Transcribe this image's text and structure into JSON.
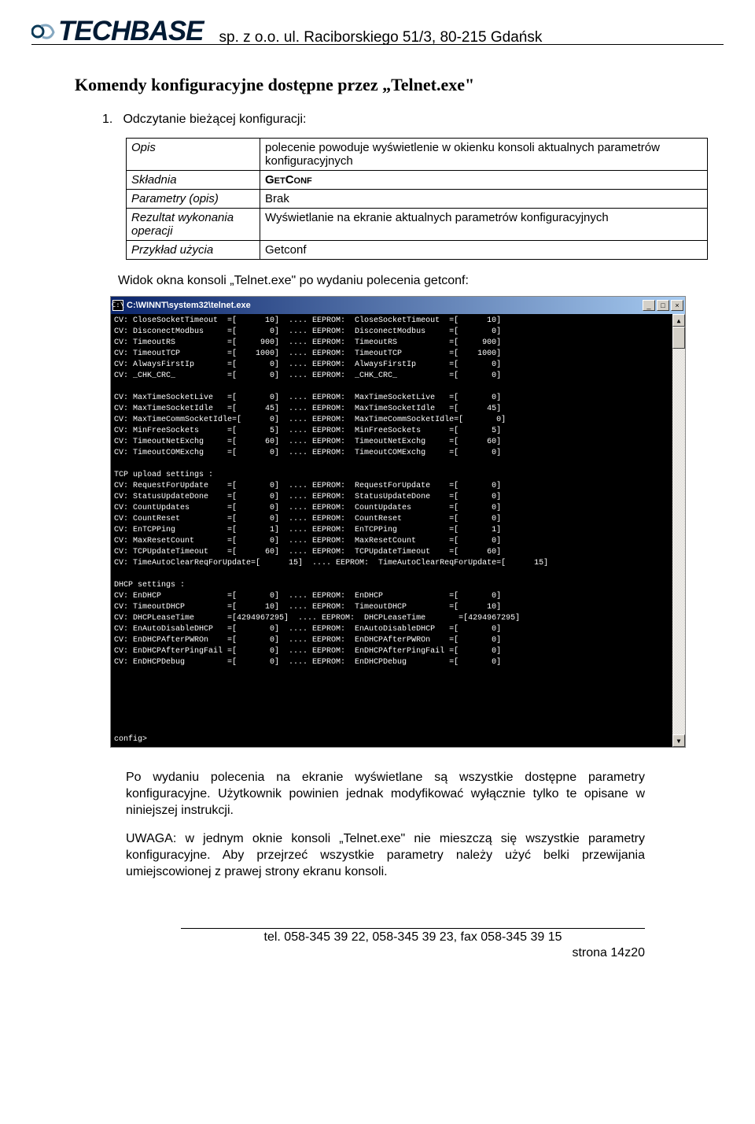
{
  "header": {
    "logo_text": "TECHBASE",
    "company": "sp. z o.o. ul. Raciborskiego 51/3, 80-215 Gdańsk"
  },
  "section_title": "Komendy konfiguracyjne dostępne przez „Telnet.exe\"",
  "list_item": {
    "num": "1.",
    "text": "Odczytanie bieżącej konfiguracji:"
  },
  "table": {
    "r0": {
      "label": "Opis",
      "value": "polecenie powoduje wyświetlenie w okienku konsoli aktualnych parametrów konfiguracyjnych"
    },
    "r1": {
      "label": "Składnia",
      "value": "GetConf"
    },
    "r2": {
      "label": "Parametry (opis)",
      "value": "Brak"
    },
    "r3": {
      "label": "Rezultat wykonania operacji",
      "value": "Wyświetlanie na ekranie aktualnych parametrów konfiguracyjnych"
    },
    "r4": {
      "label": "Przykład użycia",
      "value": "Getconf"
    }
  },
  "caption": "Widok okna konsoli „Telnet.exe\" po wydaniu polecenia getconf:",
  "console": {
    "title": "C:\\WINNT\\system32\\telnet.exe",
    "minimize": "_",
    "maximize": "□",
    "close": "×",
    "up": "▲",
    "down": "▼",
    "body": "CV: CloseSocketTimeout  =[      10]  .... EEPROM:  CloseSocketTimeout  =[      10]\nCV: DisconectModbus     =[       0]  .... EEPROM:  DisconectModbus     =[       0]\nCV: TimeoutRS           =[     900]  .... EEPROM:  TimeoutRS           =[     900]\nCV: TimeoutTCP          =[    1000]  .... EEPROM:  TimeoutTCP          =[    1000]\nCV: AlwaysFirstIp       =[       0]  .... EEPROM:  AlwaysFirstIp       =[       0]\nCV: _CHK_CRC_           =[       0]  .... EEPROM:  _CHK_CRC_           =[       0]\n\nCV: MaxTimeSocketLive   =[       0]  .... EEPROM:  MaxTimeSocketLive   =[       0]\nCV: MaxTimeSocketIdle   =[      45]  .... EEPROM:  MaxTimeSocketIdle   =[      45]\nCV: MaxTimeCommSocketIdle=[      0]  .... EEPROM:  MaxTimeCommSocketIdle=[       0]\nCV: MinFreeSockets      =[       5]  .... EEPROM:  MinFreeSockets      =[       5]\nCV: TimeoutNetExchg     =[      60]  .... EEPROM:  TimeoutNetExchg     =[      60]\nCV: TimeoutCOMExchg     =[       0]  .... EEPROM:  TimeoutCOMExchg     =[       0]\n\nTCP upload settings :\nCV: RequestForUpdate    =[       0]  .... EEPROM:  RequestForUpdate    =[       0]\nCV: StatusUpdateDone    =[       0]  .... EEPROM:  StatusUpdateDone    =[       0]\nCV: CountUpdates        =[       0]  .... EEPROM:  CountUpdates        =[       0]\nCV: CountReset          =[       0]  .... EEPROM:  CountReset          =[       0]\nCV: EnTCPPing           =[       1]  .... EEPROM:  EnTCPPing           =[       1]\nCV: MaxResetCount       =[       0]  .... EEPROM:  MaxResetCount       =[       0]\nCV: TCPUpdateTimeout    =[      60]  .... EEPROM:  TCPUpdateTimeout    =[      60]\nCV: TimeAutoClearReqForUpdate=[      15]  .... EEPROM:  TimeAutoClearReqForUpdate=[      15]\n\nDHCP settings :\nCV: EnDHCP              =[       0]  .... EEPROM:  EnDHCP              =[       0]\nCV: TimeoutDHCP         =[      10]  .... EEPROM:  TimeoutDHCP         =[      10]\nCV: DHCPLeaseTime       =[4294967295]  .... EEPROM:  DHCPLeaseTime       =[4294967295]\nCV: EnAutoDisableDHCP   =[       0]  .... EEPROM:  EnAutoDisableDHCP   =[       0]\nCV: EnDHCPAfterPWROn    =[       0]  .... EEPROM:  EnDHCPAfterPWROn    =[       0]\nCV: EnDHCPAfterPingFail =[       0]  .... EEPROM:  EnDHCPAfterPingFail =[       0]\nCV: EnDHCPDebug         =[       0]  .... EEPROM:  EnDHCPDebug         =[       0]\n\n\n\n\n\n\nconfig>"
  },
  "paragraphs": {
    "p1": "Po wydaniu polecenia na ekranie wyświetlane są wszystkie dostępne parametry konfiguracyjne. Użytkownik powinien jednak modyfikować wyłącznie tylko te opisane w niniejszej instrukcji.",
    "p2": "UWAGA: w jednym oknie konsoli „Telnet.exe\" nie mieszczą się wszystkie parametry konfiguracyjne. Aby przejrzeć wszystkie parametry należy użyć belki przewijania umiejscowionej z prawej strony ekranu konsoli."
  },
  "footer": {
    "contact": "tel. 058-345 39 22, 058-345 39 23, fax 058-345 39 15",
    "page": "strona 14z20"
  }
}
